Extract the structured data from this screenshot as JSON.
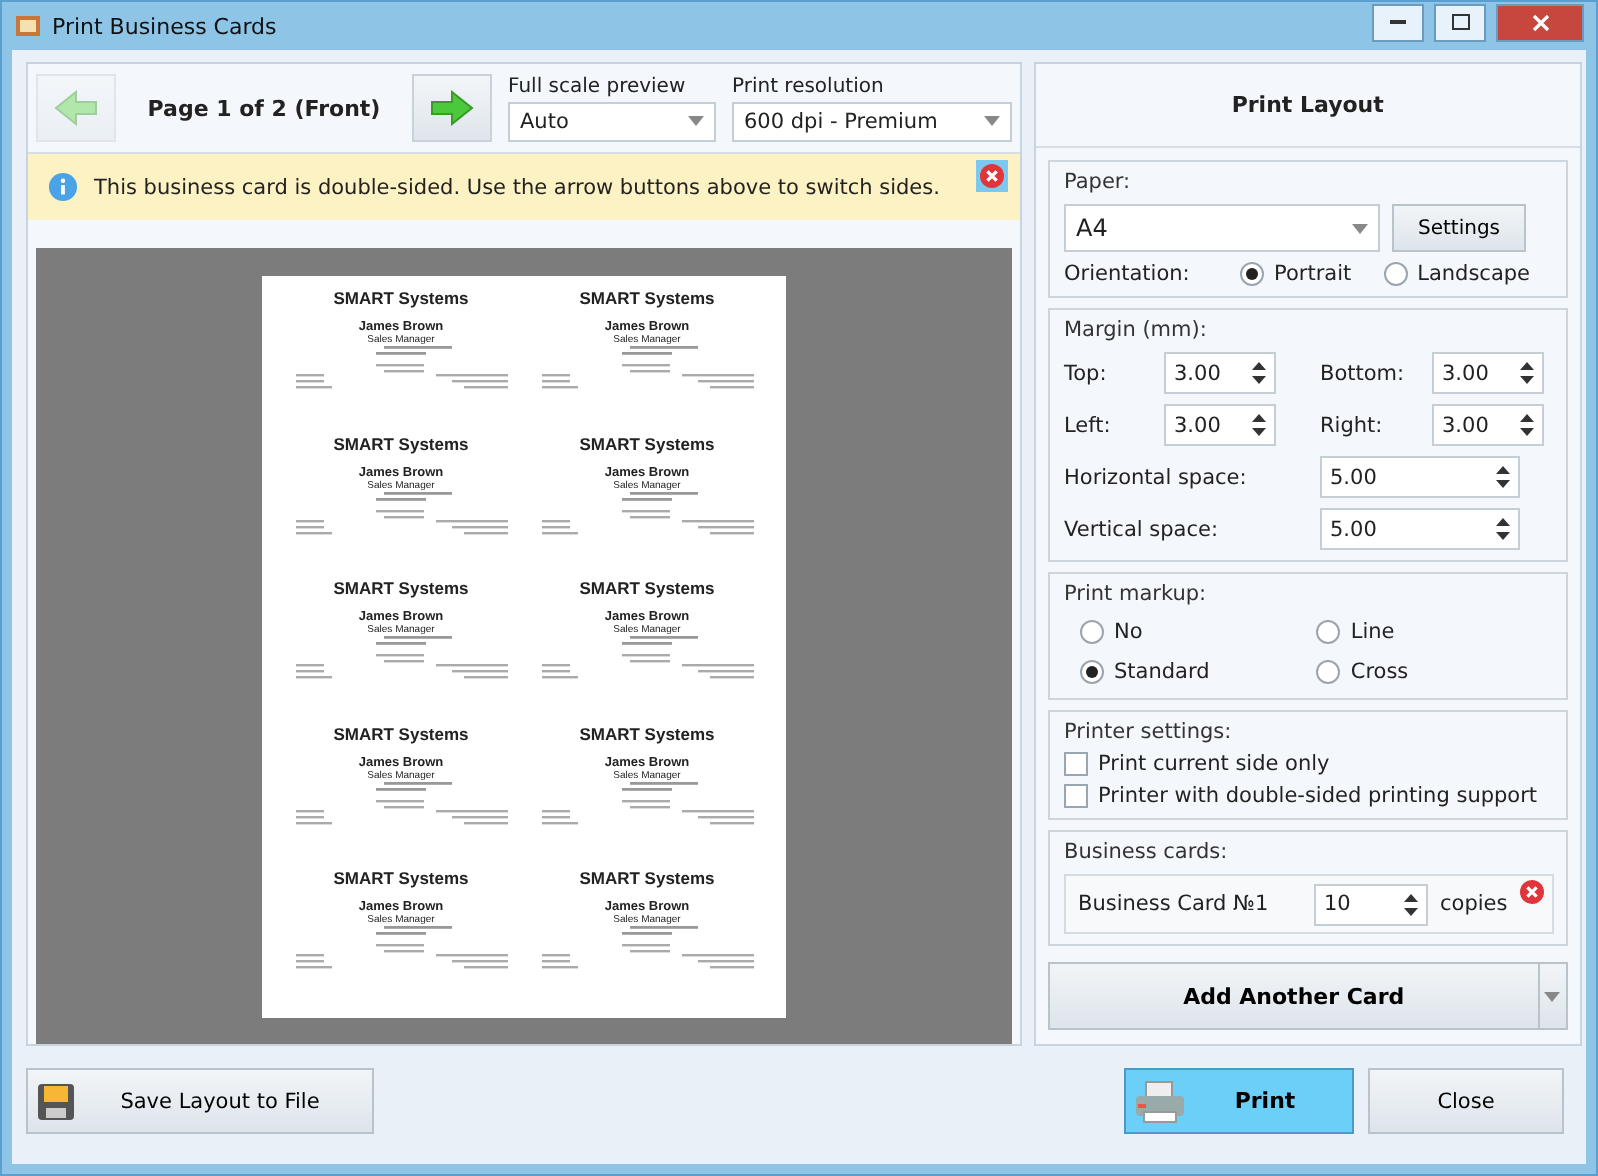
{
  "window": {
    "title": "Print Business Cards"
  },
  "toolbar": {
    "prev_disabled": true,
    "page_label": "Page 1 of 2 (Front)",
    "next_disabled": false,
    "preview": {
      "label": "Full scale preview",
      "value": "Auto"
    },
    "resolution": {
      "label": "Print resolution",
      "value": "600 dpi - Premium"
    }
  },
  "info": {
    "message": "This business card is double-sided. Use the arrow buttons above to switch sides."
  },
  "cards": [
    {
      "company": "SMART Systems",
      "name": "James Brown",
      "title": "Sales Manager"
    },
    {
      "company": "SMART Systems",
      "name": "James Brown",
      "title": "Sales Manager"
    },
    {
      "company": "SMART Systems",
      "name": "James Brown",
      "title": "Sales Manager"
    },
    {
      "company": "SMART Systems",
      "name": "James Brown",
      "title": "Sales Manager"
    },
    {
      "company": "SMART Systems",
      "name": "James Brown",
      "title": "Sales Manager"
    },
    {
      "company": "SMART Systems",
      "name": "James Brown",
      "title": "Sales Manager"
    },
    {
      "company": "SMART Systems",
      "name": "James Brown",
      "title": "Sales Manager"
    },
    {
      "company": "SMART Systems",
      "name": "James Brown",
      "title": "Sales Manager"
    },
    {
      "company": "SMART Systems",
      "name": "James Brown",
      "title": "Sales Manager"
    },
    {
      "company": "SMART Systems",
      "name": "James Brown",
      "title": "Sales Manager"
    }
  ],
  "panel": {
    "title": "Print Layout",
    "paper": {
      "legend": "Paper:",
      "value": "A4",
      "settings": "Settings",
      "orientation_label": "Orientation:",
      "orientations": [
        {
          "label": "Portrait",
          "selected": true
        },
        {
          "label": "Landscape",
          "selected": false
        }
      ]
    },
    "margin": {
      "legend": "Margin (mm):",
      "fields": [
        {
          "label": "Top:",
          "value": "3.00"
        },
        {
          "label": "Bottom:",
          "value": "3.00"
        },
        {
          "label": "Left:",
          "value": "3.00"
        },
        {
          "label": "Right:",
          "value": "3.00"
        }
      ],
      "spaces": [
        {
          "label": "Horizontal space:",
          "value": "5.00"
        },
        {
          "label": "Vertical space:",
          "value": "5.00"
        }
      ]
    },
    "markup": {
      "legend": "Print markup:",
      "options": [
        {
          "label": "No",
          "selected": false
        },
        {
          "label": "Line",
          "selected": false
        },
        {
          "label": "Standard",
          "selected": true
        },
        {
          "label": "Cross",
          "selected": false
        }
      ]
    },
    "printer": {
      "legend": "Printer settings:",
      "options": [
        {
          "label": "Print current side only",
          "checked": false
        },
        {
          "label": "Printer with double-sided printing support",
          "checked": false
        }
      ]
    },
    "business_cards": {
      "legend": "Business cards:",
      "items": [
        {
          "name": "Business Card №1",
          "copies": "10",
          "unit": "copies"
        }
      ]
    },
    "add_button": "Add Another Card"
  },
  "footer": {
    "save": "Save Layout to File",
    "print": "Print",
    "close": "Close"
  }
}
